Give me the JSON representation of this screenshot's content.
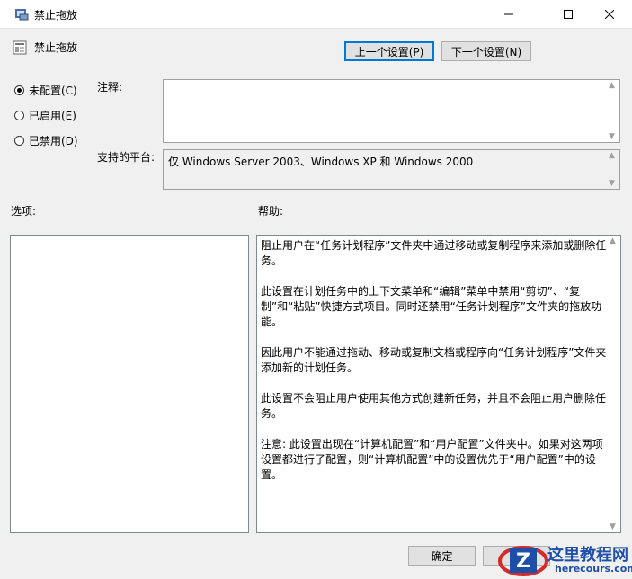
{
  "window": {
    "title": "禁止拖放",
    "controls": [
      "minimize",
      "maximize",
      "close"
    ]
  },
  "policy": {
    "name": "禁止拖放",
    "icon": "policy-setting-icon"
  },
  "nav": {
    "prev_label": "上一个设置(P)",
    "next_label": "下一个设置(N)"
  },
  "state": {
    "options": [
      {
        "label": "未配置(C)",
        "checked": true
      },
      {
        "label": "已启用(E)",
        "checked": false
      },
      {
        "label": "已禁用(D)",
        "checked": false
      }
    ]
  },
  "comment": {
    "label": "注释:",
    "value": ""
  },
  "platform": {
    "label": "支持的平台:",
    "value": "仅 Windows Server 2003、Windows XP 和 Windows 2000"
  },
  "options_panel": {
    "label": "选项:"
  },
  "help": {
    "label": "帮助:",
    "paragraphs": [
      "阻止用户在“任务计划程序”文件夹中通过移动或复制程序来添加或删除任务。",
      "此设置在计划任务中的上下文菜单和“编辑”菜单中禁用“剪切”、“复制”和“粘贴”快捷方式项目。同时还禁用“任务计划程序”文件夹的拖放功能。",
      "因此用户不能通过拖动、移动或复制文档或程序向“任务计划程序”文件夹添加新的计划任务。",
      "此设置不会阻止用户使用其他方式创建新任务，并且不会阻止用户删除任务。",
      "注意: 此设置出现在“计算机配置”和“用户配置”文件夹中。如果对这两项设置都进行了配置，则“计算机配置”中的设置优先于“用户配置”中的设置。"
    ]
  },
  "footer": {
    "ok_label": "确定",
    "cancel_label": ""
  },
  "watermark": {
    "title": "这里教程网",
    "url": "herecours.com"
  },
  "colors": {
    "window_bg": "#f0f0f0",
    "accent": "#0078d7",
    "watermark_blue": "#1d4ea8",
    "watermark_red": "#d42a2a"
  }
}
